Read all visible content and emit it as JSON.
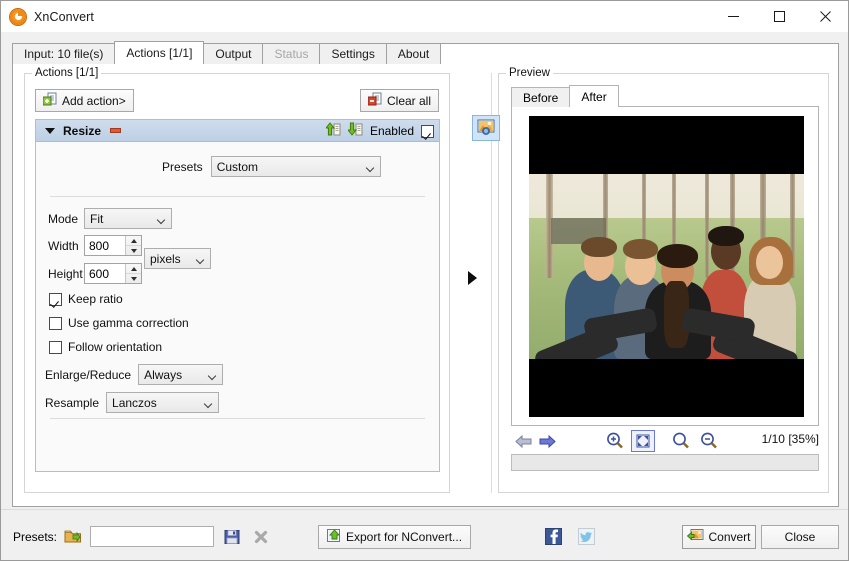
{
  "window": {
    "title": "XnConvert",
    "app_icon": "xnconvert-gear-icon",
    "minimize_label": "Minimize",
    "maximize_label": "Maximize",
    "close_label": "Close"
  },
  "tabs": [
    {
      "label": "Input: 10 file(s)",
      "name": "tab-input",
      "active": false,
      "disabled": false
    },
    {
      "label": "Actions [1/1]",
      "name": "tab-actions",
      "active": true,
      "disabled": false
    },
    {
      "label": "Output",
      "name": "tab-output",
      "active": false,
      "disabled": false
    },
    {
      "label": "Status",
      "name": "tab-status",
      "active": false,
      "disabled": true
    },
    {
      "label": "Settings",
      "name": "tab-settings",
      "active": false,
      "disabled": false
    },
    {
      "label": "About",
      "name": "tab-about",
      "active": false,
      "disabled": false
    }
  ],
  "actions_panel": {
    "group_title": "Actions [1/1]",
    "add_action_label": "Add action>",
    "add_action_icon": "add-document-plus-icon",
    "clear_all_label": "Clear all",
    "clear_all_icon": "remove-document-minus-icon",
    "card": {
      "title": "Resize",
      "collapse_icon": "caret-down-icon",
      "remove_icon": "minus-badge-icon",
      "move_up_icon": "move-up-green-arrow-icon",
      "move_down_icon": "move-down-green-arrow-icon",
      "enabled_label": "Enabled",
      "enabled_checked": true,
      "fields": {
        "presets_label": "Presets",
        "presets_value": "Custom",
        "mode_label": "Mode",
        "mode_value": "Fit",
        "width_label": "Width",
        "width_value": "800",
        "height_label": "Height",
        "height_value": "600",
        "unit_value": "pixels",
        "keep_ratio_label": "Keep ratio",
        "keep_ratio_checked": true,
        "gamma_label": "Use gamma correction",
        "gamma_checked": false,
        "orientation_label": "Follow orientation",
        "orientation_checked": false,
        "enlarge_reduce_label": "Enlarge/Reduce",
        "enlarge_reduce_value": "Always",
        "resample_label": "Resample",
        "resample_value": "Lanczos"
      }
    }
  },
  "splitter": {
    "expand_icon": "triangle-right-icon"
  },
  "preview_panel": {
    "toggle_icon": "image-preview-icon",
    "group_title": "Preview",
    "tabs": [
      {
        "label": "Before",
        "name": "preview-tab-before",
        "active": false
      },
      {
        "label": "After",
        "name": "preview-tab-after",
        "active": true
      }
    ],
    "image_alt": "group-selfie-photo",
    "toolbar": {
      "prev_icon": "arrow-left-icon",
      "next_icon": "arrow-right-icon",
      "zoom_in_icon": "zoom-in-icon",
      "fit_icon": "fit-to-window-icon",
      "actual_size_icon": "magnifier-icon",
      "zoom_out_icon": "zoom-out-icon",
      "zoom_label": "1/10 [35%]"
    }
  },
  "bottom_bar": {
    "presets_label": "Presets:",
    "open_folder_icon": "open-folder-icon",
    "preset_combo_value": "",
    "preset_combo_placeholder": "",
    "save_icon": "floppy-save-icon",
    "delete_icon": "delete-x-icon",
    "export_label": "Export for NConvert...",
    "export_icon": "export-arrow-icon",
    "facebook_icon": "facebook-icon",
    "twitter_icon": "twitter-icon",
    "convert_label": "Convert",
    "convert_icon": "convert-images-icon",
    "close_label": "Close"
  },
  "colors": {
    "accent_blue": "#cfdcec",
    "window_bg": "#f0f0f0",
    "card_bg": "#fafafa",
    "brand_orange": "#f08a16",
    "green": "#7ab800",
    "red": "#e05a3a",
    "facebook_blue": "#3b5998",
    "twitter_blue": "#7fc3e8"
  }
}
